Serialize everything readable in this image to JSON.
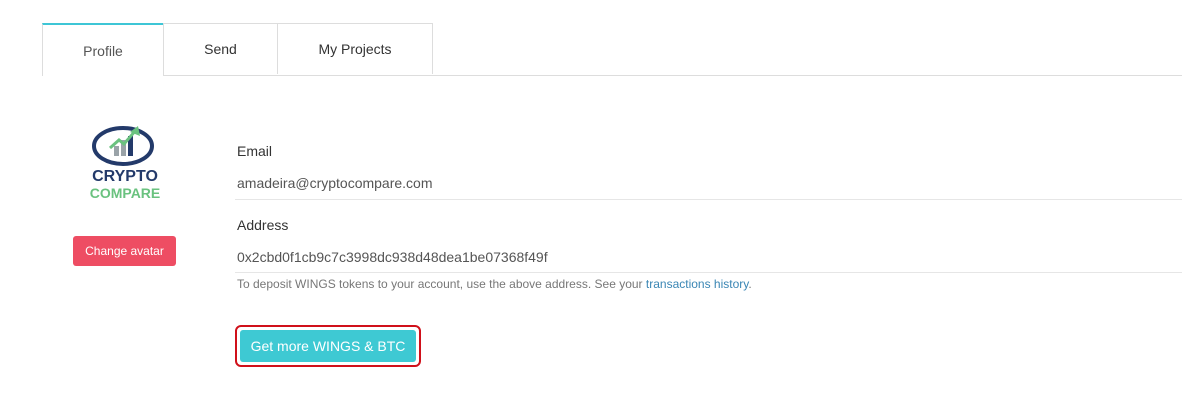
{
  "tabs": [
    {
      "label": "Profile",
      "active": true
    },
    {
      "label": "Send",
      "active": false
    },
    {
      "label": "My Projects",
      "active": false
    }
  ],
  "logo": {
    "line1": "CRYPTO",
    "line2": "COMPARE",
    "colors": {
      "dark": "#233a6a",
      "green": "#6ac27f"
    }
  },
  "avatar": {
    "change_label": "Change avatar"
  },
  "profile": {
    "email_label": "Email",
    "email_value": "amadeira@cryptocompare.com",
    "address_label": "Address",
    "address_value": "0x2cbd0f1cb9c7c3998dc938d48dea1be07368f49f",
    "help_prefix": "To deposit WINGS tokens to your account, use the above address. See your ",
    "help_link": "transactions history",
    "help_suffix": "."
  },
  "cta": {
    "label": "Get more WINGS & BTC"
  },
  "colors": {
    "accent": "#3ec6d6",
    "danger": "#ee4d63",
    "link": "#3a86b4",
    "highlight": "#d0101a"
  }
}
